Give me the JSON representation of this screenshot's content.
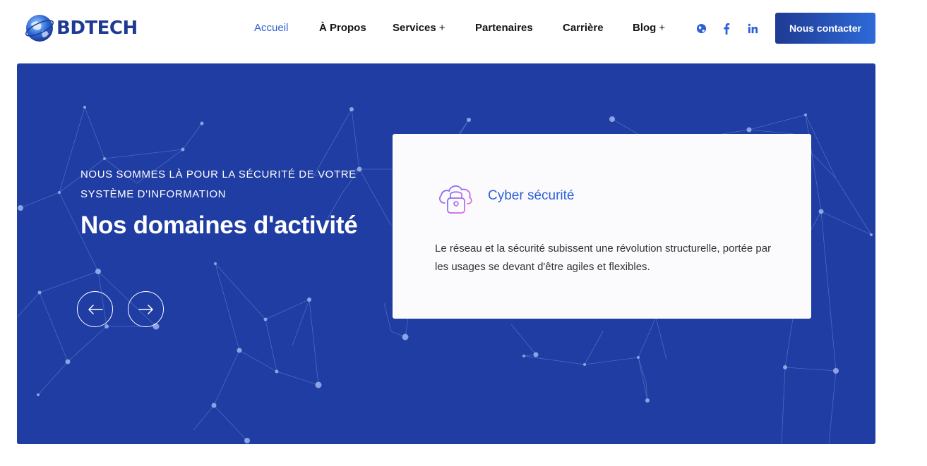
{
  "header": {
    "logo_text": "BDTECH",
    "nav": [
      {
        "label": "Accueil",
        "active": true,
        "has_submenu": false
      },
      {
        "label": "À Propos",
        "active": false,
        "has_submenu": false
      },
      {
        "label": "Services",
        "active": false,
        "has_submenu": true
      },
      {
        "label": "Partenaires",
        "active": false,
        "has_submenu": false
      },
      {
        "label": "Carrière",
        "active": false,
        "has_submenu": false
      },
      {
        "label": "Blog",
        "active": false,
        "has_submenu": true
      }
    ],
    "submenu_symbol": "+",
    "social_icons": [
      "globe-icon",
      "facebook-icon",
      "linkedin-icon"
    ],
    "contact_button": "Nous contacter"
  },
  "hero": {
    "eyebrow": "NOUS SOMMES LÀ POUR LA SÉCURITÉ DE VOTRE SYSTÈME D'INFORMATION",
    "title": "Nos domaines d'activité",
    "prev_icon": "arrow-left-icon",
    "next_icon": "arrow-right-icon"
  },
  "card": {
    "icon": "cloud-lock-icon",
    "title": "Cyber sécurité",
    "text": "Le réseau et la sécurité subissent une révolution structurelle, portée par les usages se devant d'être agiles et flexibles."
  },
  "colors": {
    "accent": "#2e5fd6",
    "hero_background": "#1f3da2",
    "brand_dark": "#1f3a93",
    "card_background": "#fbfbfd"
  }
}
